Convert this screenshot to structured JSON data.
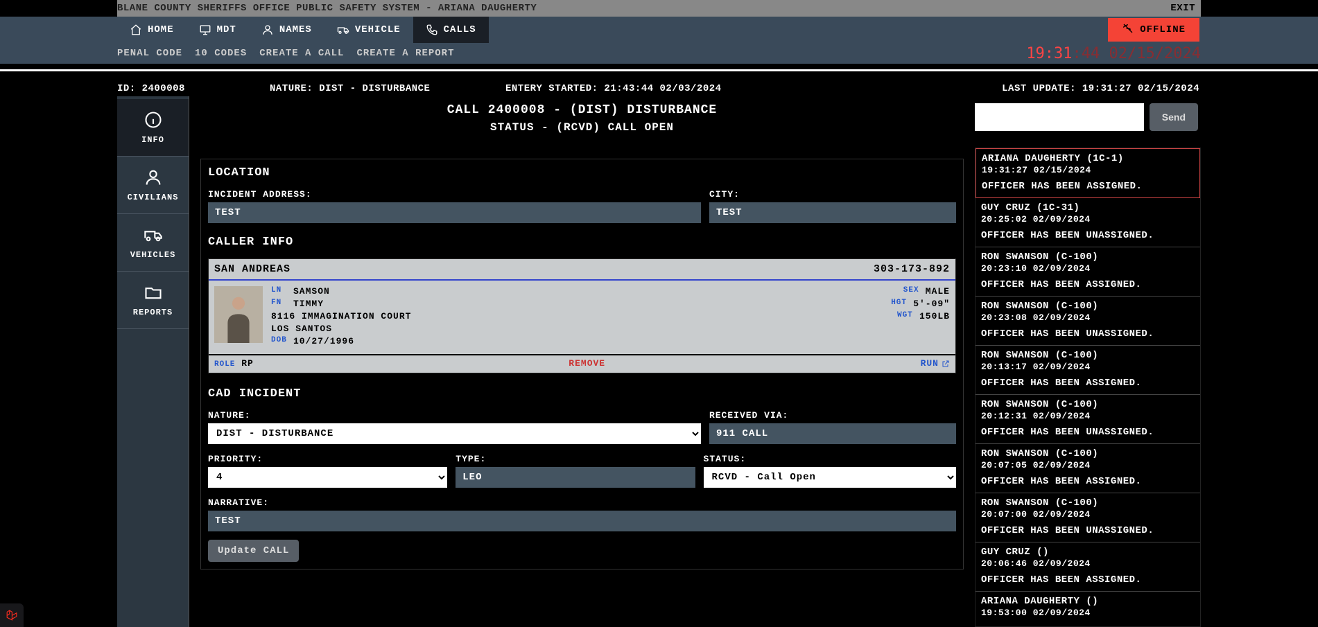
{
  "title_bar": {
    "text": "BLANE COUNTY SHERIFFS OFFICE PUBLIC SAFETY SYSTEM - ARIANA DAUGHERTY",
    "exit": "EXIT"
  },
  "nav": {
    "home": "HOME",
    "mdt": "MDT",
    "names": "NAMES",
    "vehicle": "VEHICLE",
    "calls": "CALLS",
    "offline": "OFFLINE"
  },
  "subnav": {
    "penal": "PENAL CODE",
    "codes": "10 CODES",
    "create_call": "CREATE A CALL",
    "create_report": "CREATE A REPORT",
    "clock_time": "19:31",
    "clock_sec": ":44",
    "clock_date": "02/15/2024"
  },
  "infobar": {
    "id": "ID: 2400008",
    "nature": "NATURE: DIST - DISTURBANCE",
    "entry": "ENTERY STARTED: 21:43:44 02/03/2024",
    "update": "LAST UPDATE: 19:31:27 02/15/2024"
  },
  "rail": {
    "info": "INFO",
    "civilians": "CIVILIANS",
    "vehicles": "VEHICLES",
    "reports": "REPORTS"
  },
  "header": {
    "title": "CALL 2400008 - (DIST) DISTURBANCE",
    "status": "STATUS - (RCVD) CALL OPEN"
  },
  "form": {
    "location_h": "LOCATION",
    "incident_address_lbl": "INCIDENT ADDRESS:",
    "incident_address_val": "TEST",
    "city_lbl": "CITY:",
    "city_val": "TEST",
    "caller_h": "CALLER INFO",
    "cad_h": "CAD INCIDENT",
    "nature_lbl": "NATURE:",
    "nature_val": "DIST - DISTURBANCE",
    "received_lbl": "RECEIVED VIA:",
    "received_val": "911 CALL",
    "priority_lbl": "PRIORITY:",
    "priority_val": "4",
    "type_lbl": "TYPE:",
    "type_val": "LEO",
    "status_lbl": "STATUS:",
    "status_val": "RCVD - Call Open",
    "narrative_lbl": "NARRATIVE:",
    "narrative_val": "TEST",
    "update_btn": "Update CALL"
  },
  "caller": {
    "state": "SAN ANDREAS",
    "ssn": "303-173-892",
    "ln_lbl": "LN",
    "ln": "SAMSON",
    "fn_lbl": "FN",
    "fn": "TIMMY",
    "addr": "8116 IMMAGINATION COURT",
    "city": "LOS SANTOS",
    "dob_lbl": "DOB",
    "dob": "10/27/1996",
    "sex_lbl": "SEX",
    "sex": "MALE",
    "hgt_lbl": "HGT",
    "hgt": "5'-09\"",
    "wgt_lbl": "WGT",
    "wgt": "150LB",
    "role_lbl": "ROLE",
    "role": "RP",
    "remove": "REMOVE",
    "run": "RUN"
  },
  "send": {
    "btn": "Send"
  },
  "log": [
    {
      "sender": "ARIANA DAUGHERTY (1C-1)",
      "time": "19:31:27 02/15/2024",
      "msg": "OFFICER HAS BEEN ASSIGNED.",
      "hl": true
    },
    {
      "sender": "GUY CRUZ (1C-31)",
      "time": "20:25:02 02/09/2024",
      "msg": "OFFICER HAS BEEN UNASSIGNED."
    },
    {
      "sender": "RON SWANSON (C-100)",
      "time": "20:23:10 02/09/2024",
      "msg": "OFFICER HAS BEEN ASSIGNED."
    },
    {
      "sender": "RON SWANSON (C-100)",
      "time": "20:23:08 02/09/2024",
      "msg": "OFFICER HAS BEEN UNASSIGNED."
    },
    {
      "sender": "RON SWANSON (C-100)",
      "time": "20:13:17 02/09/2024",
      "msg": "OFFICER HAS BEEN ASSIGNED."
    },
    {
      "sender": "RON SWANSON (C-100)",
      "time": "20:12:31 02/09/2024",
      "msg": "OFFICER HAS BEEN UNASSIGNED."
    },
    {
      "sender": "RON SWANSON (C-100)",
      "time": "20:07:05 02/09/2024",
      "msg": "OFFICER HAS BEEN ASSIGNED."
    },
    {
      "sender": "RON SWANSON (C-100)",
      "time": "20:07:00 02/09/2024",
      "msg": "OFFICER HAS BEEN UNASSIGNED."
    },
    {
      "sender": "GUY CRUZ ()",
      "time": "20:06:46 02/09/2024",
      "msg": "OFFICER HAS BEEN ASSIGNED."
    },
    {
      "sender": "ARIANA DAUGHERTY ()",
      "time": "19:53:00 02/09/2024",
      "msg": ""
    }
  ]
}
